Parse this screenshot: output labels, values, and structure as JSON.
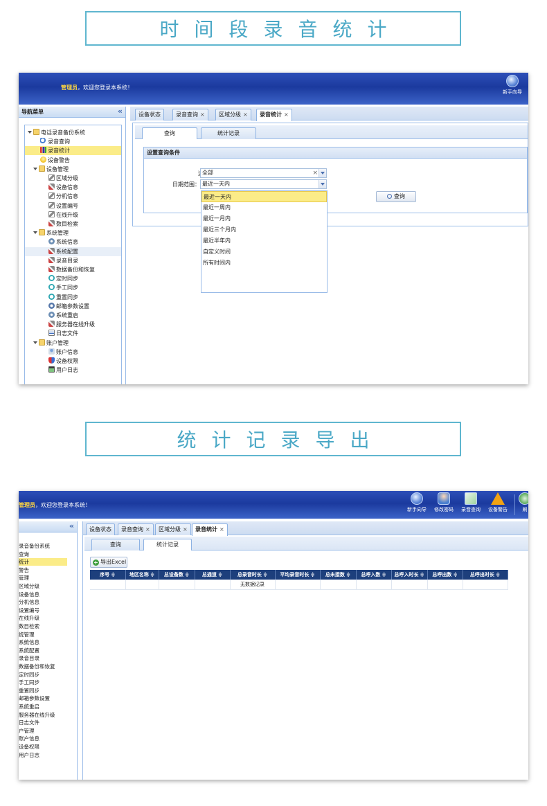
{
  "titles": {
    "section1": "时间段录音统计",
    "section2": "统计记录导出"
  },
  "header": {
    "admin": "管理员",
    "welcome_rest": "，欢迎您登录本系统！",
    "tools1": [
      {
        "label": "新手向导",
        "icon": "guide-icon"
      }
    ],
    "tools2": [
      {
        "label": "新手向导",
        "icon": "guide-icon"
      },
      {
        "label": "修改密码",
        "icon": "password-icon"
      },
      {
        "label": "录音查询",
        "icon": "record-query-icon"
      },
      {
        "label": "设备警告",
        "icon": "warning-icon"
      },
      {
        "label": "刷",
        "icon": "refresh-icon"
      }
    ]
  },
  "sidebar": {
    "title": "导航菜单",
    "collapse": "«",
    "tree": [
      {
        "label": "电话录音备份系统",
        "level": 0,
        "icon": "folder",
        "expanded": true
      },
      {
        "label": "录音查询",
        "level": 1,
        "icon": "search"
      },
      {
        "label": "录音统计",
        "level": 1,
        "icon": "bar",
        "selected": true
      },
      {
        "label": "设备警告",
        "level": 1,
        "icon": "bulb"
      },
      {
        "label": "设备管理",
        "level": 1,
        "icon": "folder",
        "expanded": true
      },
      {
        "label": "区域分级",
        "level": 2,
        "icon": "pencil"
      },
      {
        "label": "设备信息",
        "level": 2,
        "icon": "tools"
      },
      {
        "label": "分机信息",
        "level": 2,
        "icon": "pencil"
      },
      {
        "label": "设置编号",
        "level": 2,
        "icon": "pencil"
      },
      {
        "label": "在线升级",
        "level": 2,
        "icon": "pencil"
      },
      {
        "label": "数目检索",
        "level": 2,
        "icon": "tools"
      },
      {
        "label": "系统管理",
        "level": 1,
        "icon": "folder",
        "expanded": true
      },
      {
        "label": "系统信息",
        "level": 2,
        "icon": "gear"
      },
      {
        "label": "系统配置",
        "level": 2,
        "icon": "tools",
        "hover": true
      },
      {
        "label": "录音目录",
        "level": 2,
        "icon": "tools"
      },
      {
        "label": "数据备份和恢复",
        "level": 2,
        "icon": "tools"
      },
      {
        "label": "定时同步",
        "level": 2,
        "icon": "clock"
      },
      {
        "label": "手工同步",
        "level": 2,
        "icon": "clock"
      },
      {
        "label": "重置同步",
        "level": 2,
        "icon": "clock"
      },
      {
        "label": "邮箱参数设置",
        "level": 2,
        "icon": "mail"
      },
      {
        "label": "系统重启",
        "level": 2,
        "icon": "gear"
      },
      {
        "label": "服务器在线升级",
        "level": 2,
        "icon": "tools"
      },
      {
        "label": "日志文件",
        "level": 2,
        "icon": "doc"
      },
      {
        "label": "账户管理",
        "level": 1,
        "icon": "folder",
        "expanded": true
      },
      {
        "label": "账户信息",
        "level": 2,
        "icon": "user"
      },
      {
        "label": "设备权限",
        "level": 2,
        "icon": "shield"
      },
      {
        "label": "用户日志",
        "level": 2,
        "icon": "log"
      }
    ],
    "tree_cropped": [
      "录音备份系统",
      "查询",
      "统计",
      "警告",
      "管理",
      "区域分级",
      "设备信息",
      "分机信息",
      "设置编号",
      "在线升级",
      "数目检索",
      "统管理",
      "系统信息",
      "系统配置",
      "录音目录",
      "数据备份和恢复",
      "定时同步",
      "手工同步",
      "重置同步",
      "邮箱参数设置",
      "系统重启",
      "服务器在线升级",
      "日志文件",
      "户管理",
      "账户信息",
      "设备权限",
      "用户日志"
    ]
  },
  "tabs": [
    {
      "label": "设备状态",
      "closable": false
    },
    {
      "label": "录音查询",
      "closable": true
    },
    {
      "label": "区域分级",
      "closable": true
    },
    {
      "label": "录音统计",
      "closable": true,
      "active": true
    }
  ],
  "close_glyph": "×",
  "subtabs": [
    "查询",
    "统计记录"
  ],
  "query_panel": {
    "title": "设置查询条件",
    "area_label": "选择区域",
    "area_value": "全部",
    "clear_glyph": "×",
    "date_label": "日期范围：",
    "date_value": "最近一天内",
    "options": [
      "最近一天内",
      "最近一周内",
      "最近一月内",
      "最近三个月内",
      "最近半年内",
      "自定义时间",
      "所有时间内"
    ],
    "query_button": "查询"
  },
  "export": {
    "button": "导出Excel",
    "columns": [
      "序号 ≑",
      "地区名称 ≑",
      "总设备数 ≑",
      "总通道 ≑",
      "总录音时长 ≑",
      "平均录音时长 ≑",
      "总未接数 ≑",
      "总呼入数 ≑",
      "总呼入时长 ≑",
      "总呼出数 ≑",
      "总呼出时长 ≑"
    ],
    "empty_text": "无数据记录"
  },
  "colors": {
    "accent": "#4aa8c6",
    "header_blue": "#1b3a9e",
    "grid_header": "#1d3f7c",
    "highlight": "#fbec88"
  }
}
